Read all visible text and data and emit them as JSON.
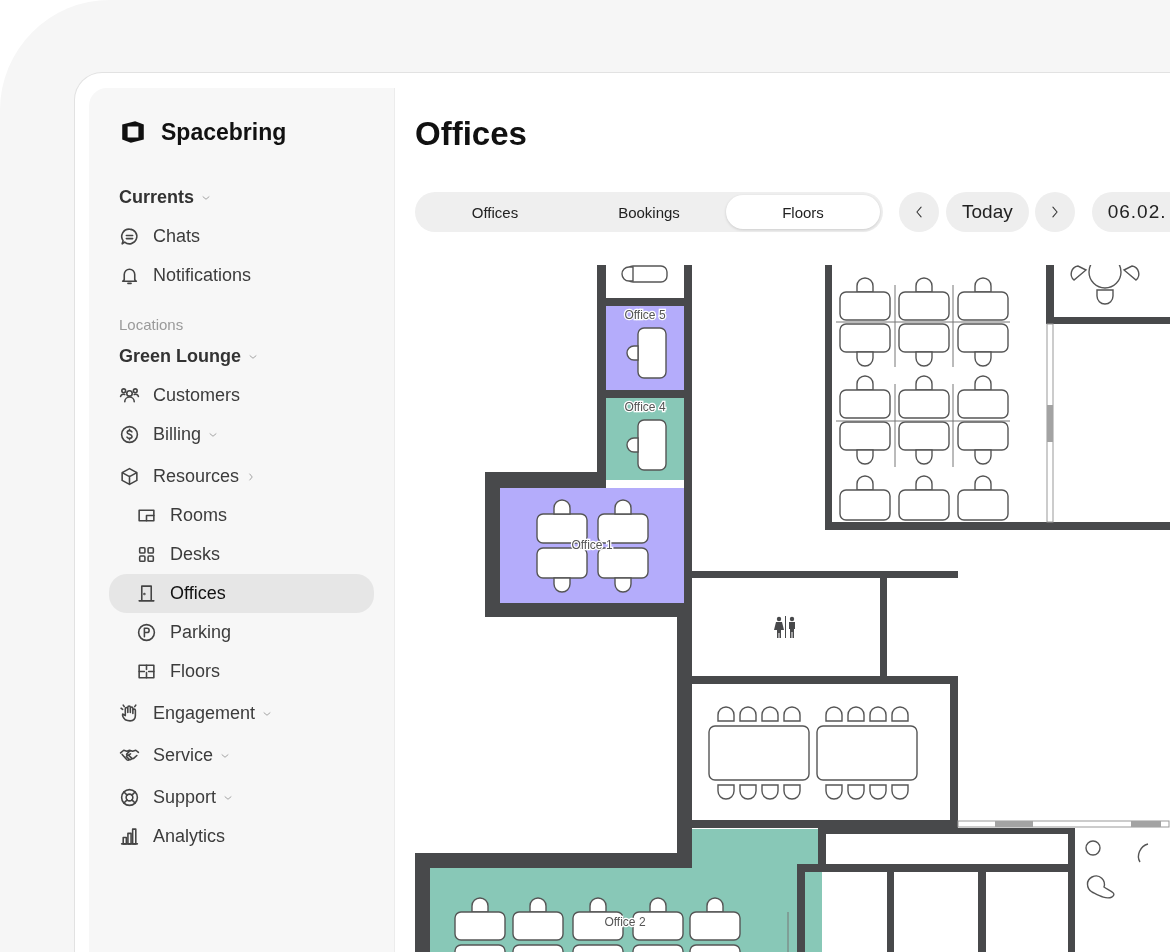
{
  "brand": {
    "name": "Spacebring"
  },
  "sidebar": {
    "items": [
      {
        "kind": "group",
        "label": "Currents",
        "expanded": true,
        "selected": false
      },
      {
        "kind": "item",
        "label": "Chats",
        "selected": false
      },
      {
        "kind": "item",
        "label": "Notifications",
        "selected": false
      },
      {
        "kind": "section",
        "label": "Locations"
      },
      {
        "kind": "group",
        "label": "Green Lounge",
        "expanded": true,
        "selected": false
      },
      {
        "kind": "item",
        "label": "Customers",
        "selected": false
      },
      {
        "kind": "item",
        "label": "Billing",
        "expanded": true,
        "selected": false
      },
      {
        "kind": "item",
        "label": "Resources",
        "expanded": false,
        "selected": false,
        "children": [
          {
            "kind": "item",
            "label": "Rooms",
            "selected": false
          },
          {
            "kind": "item",
            "label": "Desks",
            "selected": false
          },
          {
            "kind": "item",
            "label": "Offices",
            "selected": true
          },
          {
            "kind": "item",
            "label": "Parking",
            "selected": false
          },
          {
            "kind": "item",
            "label": "Floors",
            "selected": false
          }
        ]
      },
      {
        "kind": "item",
        "label": "Engagement",
        "expanded": true,
        "selected": false
      },
      {
        "kind": "item",
        "label": "Service",
        "expanded": true,
        "selected": false
      },
      {
        "kind": "item",
        "label": "Support",
        "expanded": true,
        "selected": false
      },
      {
        "kind": "item",
        "label": "Analytics",
        "selected": false
      }
    ]
  },
  "page": {
    "title": "Offices"
  },
  "tabs": [
    {
      "label": "Offices",
      "selected": false
    },
    {
      "label": "Bookings",
      "selected": false
    },
    {
      "label": "Floors",
      "selected": true
    }
  ],
  "date_nav": {
    "today": "Today",
    "date": "06.02."
  },
  "floor_plan": {
    "offices": [
      {
        "label": "Office 5",
        "color": "#b4acfb"
      },
      {
        "label": "Office 4",
        "color": "#88c8b7"
      },
      {
        "label": "Office 1",
        "color": "#b4acfb"
      },
      {
        "label": "Office 2",
        "color": "#88c8b7"
      }
    ]
  }
}
